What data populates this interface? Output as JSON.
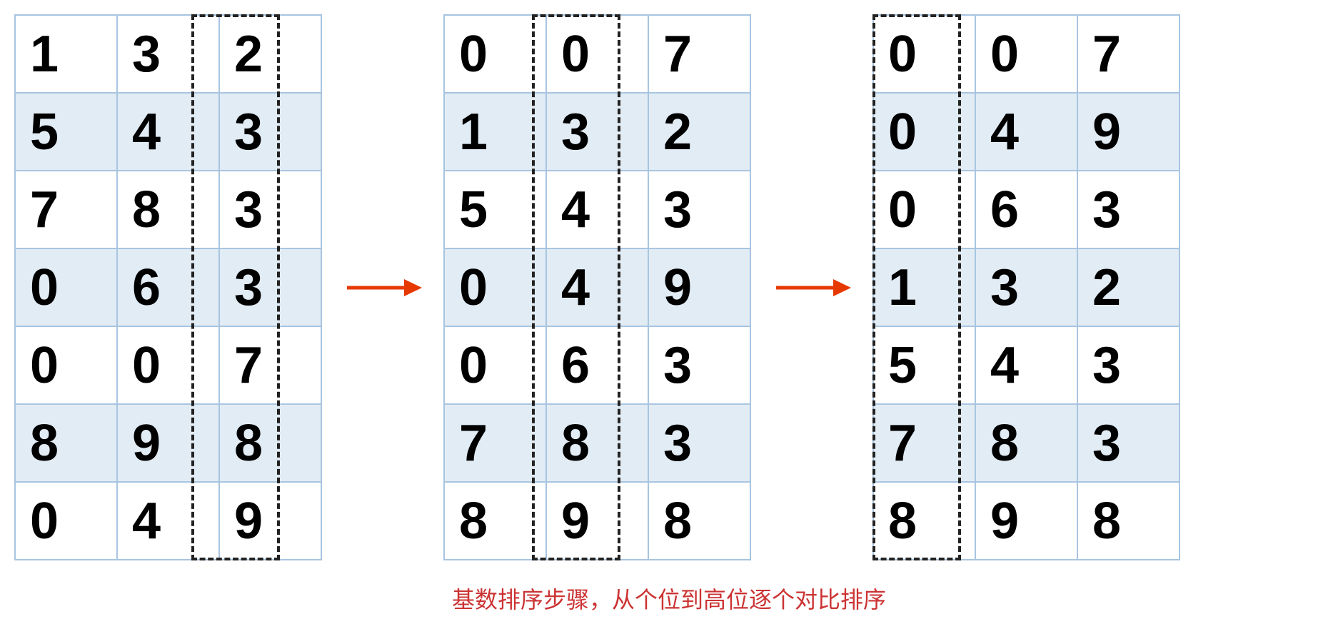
{
  "chart_data": {
    "type": "table",
    "title": "基数排序步骤，从个位到高位逐个对比排序",
    "description": "Radix sort step-by-step: sorting by comparing digits from ones place to higher places",
    "tables": [
      {
        "name": "original",
        "highlight_column": 2,
        "rows": [
          [
            "1",
            "3",
            "2"
          ],
          [
            "5",
            "4",
            "3"
          ],
          [
            "7",
            "8",
            "3"
          ],
          [
            "0",
            "6",
            "3"
          ],
          [
            "0",
            "0",
            "7"
          ],
          [
            "8",
            "9",
            "8"
          ],
          [
            "0",
            "4",
            "9"
          ]
        ]
      },
      {
        "name": "after-ones-digit-sort",
        "highlight_column": 1,
        "rows": [
          [
            "0",
            "0",
            "7"
          ],
          [
            "1",
            "3",
            "2"
          ],
          [
            "5",
            "4",
            "3"
          ],
          [
            "0",
            "4",
            "9"
          ],
          [
            "0",
            "6",
            "3"
          ],
          [
            "7",
            "8",
            "3"
          ],
          [
            "8",
            "9",
            "8"
          ]
        ]
      },
      {
        "name": "after-tens-digit-sort",
        "highlight_column": 0,
        "rows": [
          [
            "0",
            "0",
            "7"
          ],
          [
            "0",
            "4",
            "9"
          ],
          [
            "0",
            "6",
            "3"
          ],
          [
            "1",
            "3",
            "2"
          ],
          [
            "5",
            "4",
            "3"
          ],
          [
            "7",
            "8",
            "3"
          ],
          [
            "8",
            "9",
            "8"
          ]
        ]
      }
    ]
  },
  "caption": "基数排序步骤，从个位到高位逐个对比排序",
  "colors": {
    "border": "#a8c5e0",
    "shaded": "#e2ecf5",
    "highlight": "#222222",
    "arrow": "#e63900",
    "caption": "#cc3333"
  }
}
